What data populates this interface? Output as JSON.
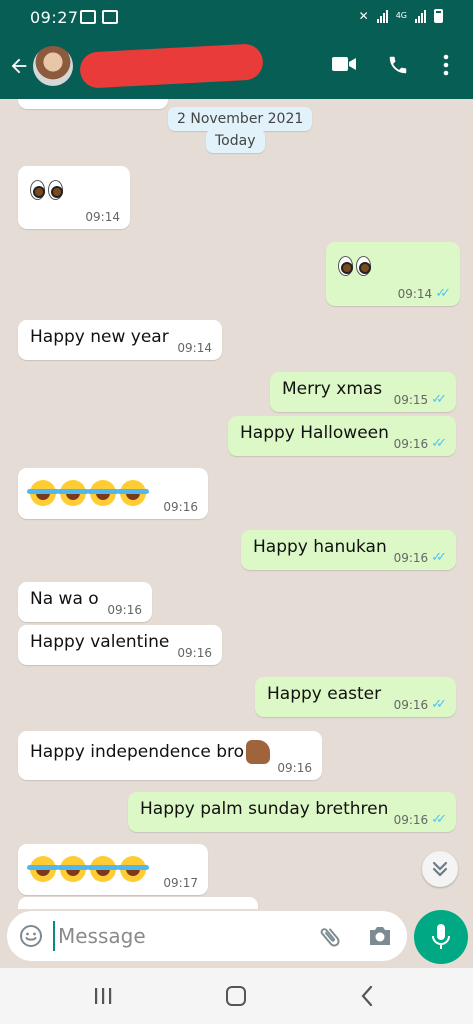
{
  "status_bar": {
    "time": "09:27",
    "network": "4G"
  },
  "chat": {
    "date_chip": "2 November 2021",
    "today_chip": "Today",
    "messages": [
      {
        "dir": "in",
        "kind": "eyes",
        "text": "👀",
        "time": "09:14"
      },
      {
        "dir": "out",
        "kind": "eyes",
        "text": "👀",
        "time": "09:14"
      },
      {
        "dir": "in",
        "kind": "text",
        "text": "Happy new year",
        "time": "09:14"
      },
      {
        "dir": "out",
        "kind": "text",
        "text": "Merry xmas",
        "time": "09:15"
      },
      {
        "dir": "out",
        "kind": "text",
        "text": "Happy Halloween",
        "time": "09:16"
      },
      {
        "dir": "in",
        "kind": "laugh",
        "text": "😂😂😂😂",
        "time": "09:16"
      },
      {
        "dir": "out",
        "kind": "text",
        "text": "Happy hanukan",
        "time": "09:16"
      },
      {
        "dir": "in",
        "kind": "text",
        "text": "Na wa o",
        "time": "09:16"
      },
      {
        "dir": "in",
        "kind": "text",
        "text": "Happy valentine",
        "time": "09:16"
      },
      {
        "dir": "out",
        "kind": "text",
        "text": "Happy easter",
        "time": "09:16"
      },
      {
        "dir": "in",
        "kind": "thumb",
        "text": "Happy independence bro👍🏽",
        "time": "09:16"
      },
      {
        "dir": "out",
        "kind": "text",
        "text": "Happy palm sunday brethren",
        "time": "09:16"
      },
      {
        "dir": "in",
        "kind": "laugh",
        "text": "😂😂😂😂",
        "time": "09:17"
      }
    ]
  },
  "composer": {
    "placeholder": "Message"
  },
  "colors": {
    "header": "#075e54",
    "outgoing": "#dcf8c6",
    "incoming": "#ffffff",
    "mic": "#00a884",
    "ticks": "#4fc3f7"
  },
  "icons": [
    "back-arrow-icon",
    "video-call-icon",
    "phone-icon",
    "more-vert-icon",
    "emoji-icon",
    "attach-icon",
    "camera-icon",
    "mic-icon",
    "double-chevron-down-icon"
  ]
}
